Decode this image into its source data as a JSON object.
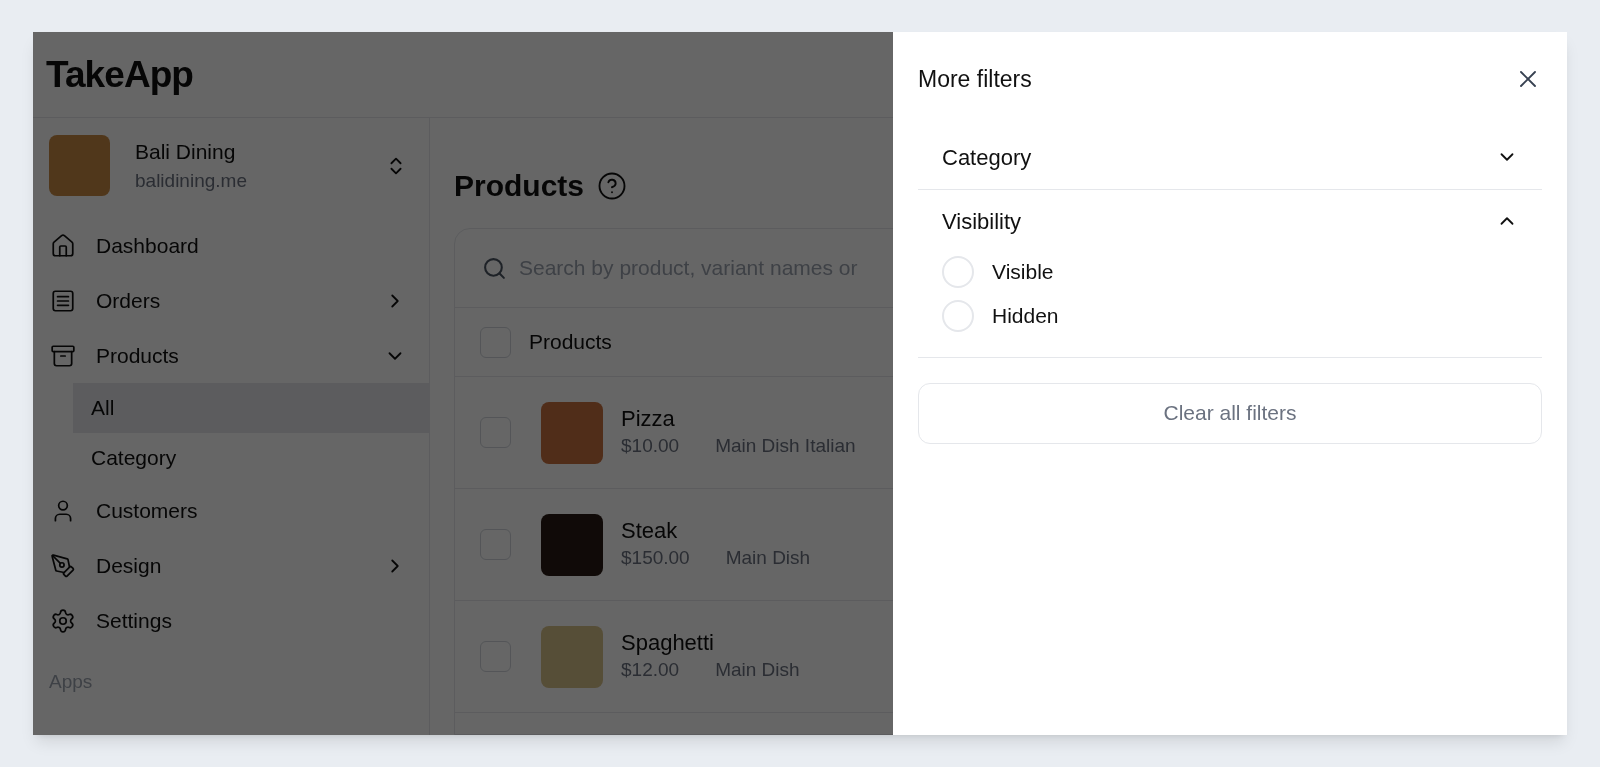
{
  "logo": "TakeApp",
  "store": {
    "name": "Bali Dining",
    "domain": "balidining.me"
  },
  "sidebar": {
    "items": [
      {
        "label": "Dashboard"
      },
      {
        "label": "Orders",
        "expanded": false
      },
      {
        "label": "Products",
        "expanded": true,
        "children": [
          {
            "label": "All",
            "selected": true
          },
          {
            "label": "Category",
            "selected": false
          }
        ]
      },
      {
        "label": "Customers"
      },
      {
        "label": "Design",
        "expanded": false
      },
      {
        "label": "Settings"
      }
    ],
    "section_label": "Apps"
  },
  "page": {
    "title": "Products",
    "search": {
      "placeholder": "Search by product, variant names or"
    },
    "table": {
      "header": {
        "label": "Products",
        "checked": false
      },
      "rows": [
        {
          "name": "Pizza",
          "price": "$10.00",
          "categories": "Main Dish Italian",
          "checked": false
        },
        {
          "name": "Steak",
          "price": "$150.00",
          "categories": "Main Dish",
          "checked": false
        },
        {
          "name": "Spaghetti",
          "price": "$12.00",
          "categories": "Main Dish",
          "checked": false
        }
      ]
    }
  },
  "drawer": {
    "title": "More filters",
    "sections": [
      {
        "title": "Category",
        "expanded": false
      },
      {
        "title": "Visibility",
        "expanded": true,
        "options": [
          {
            "label": "Visible",
            "selected": false
          },
          {
            "label": "Hidden",
            "selected": false
          }
        ]
      }
    ],
    "button": "Clear all filters"
  }
}
